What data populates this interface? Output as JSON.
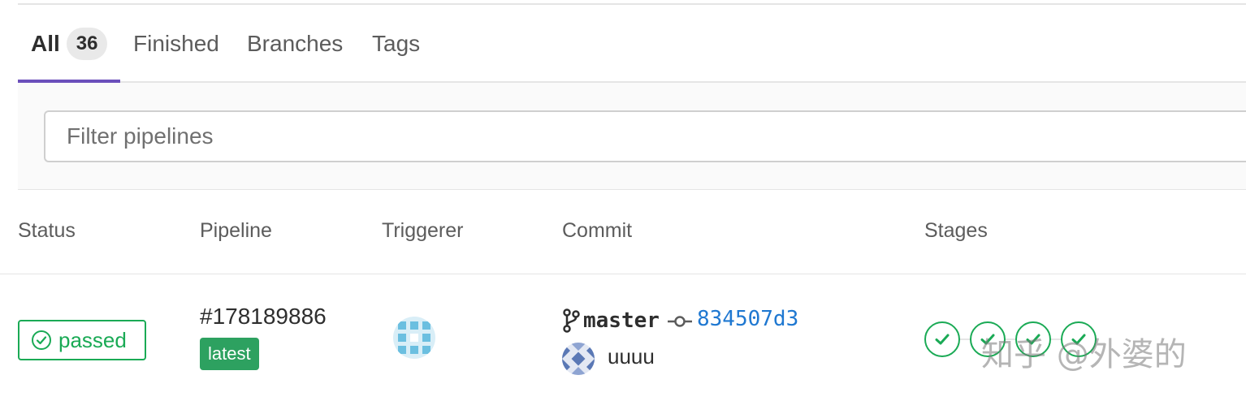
{
  "tabs": [
    {
      "label": "All",
      "count": "36",
      "active": true
    },
    {
      "label": "Finished",
      "active": false
    },
    {
      "label": "Branches",
      "active": false
    },
    {
      "label": "Tags",
      "active": false
    }
  ],
  "filter": {
    "placeholder": "Filter pipelines"
  },
  "table": {
    "headers": [
      "Status",
      "Pipeline",
      "Triggerer",
      "Commit",
      "Stages"
    ],
    "rows": [
      {
        "status": "passed",
        "pipeline_id": "#178189886",
        "badge": "latest",
        "branch": "master",
        "commit_sha": "834507d3",
        "commit_title": "uuuu",
        "stages": [
          "success",
          "success",
          "success",
          "success"
        ]
      }
    ]
  },
  "watermark": "知乎 @外婆的",
  "colors": {
    "accent": "#6b4fbb",
    "success": "#1aaa55",
    "latest_badge": "#2da160",
    "link": "#1f78d1"
  },
  "icons": {
    "status": "check-circle-icon",
    "branch": "branch-icon",
    "commit": "commit-icon",
    "stage": "check-icon"
  }
}
